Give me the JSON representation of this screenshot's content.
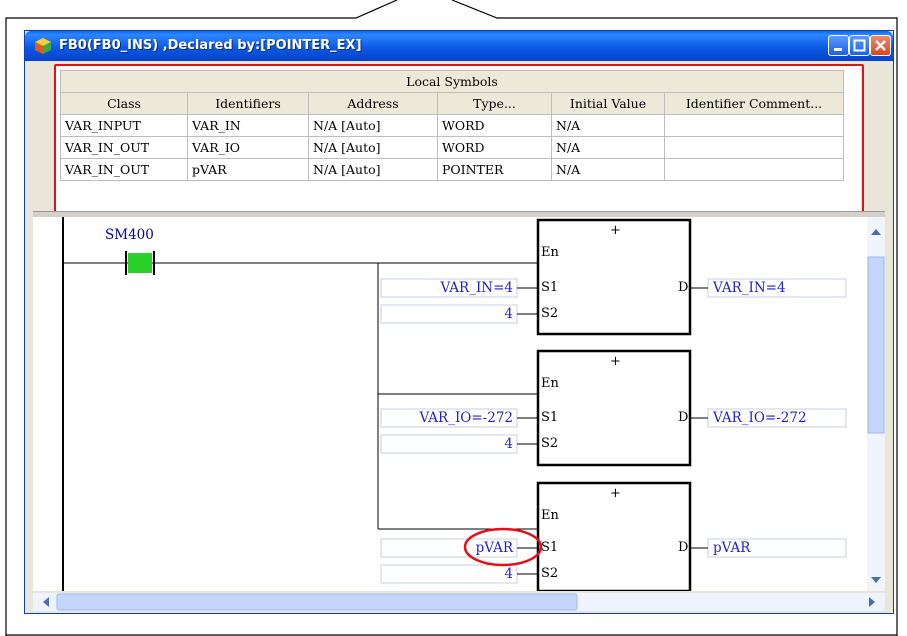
{
  "window": {
    "title": "FB0(FB0_INS) ,Declared by:[POINTER_EX]"
  },
  "symbols": {
    "caption": "Local Symbols",
    "columns": [
      "Class",
      "Identifiers",
      "Address",
      "Type...",
      "Initial Value",
      "Identifier Comment..."
    ],
    "rows": [
      [
        "VAR_INPUT",
        "VAR_IN",
        "N/A [Auto]",
        "WORD",
        "N/A",
        ""
      ],
      [
        "VAR_IN_OUT",
        "VAR_IO",
        "N/A [Auto]",
        "WORD",
        "N/A",
        ""
      ],
      [
        "VAR_IN_OUT",
        "pVAR",
        "N/A [Auto]",
        "POINTER",
        "N/A",
        ""
      ]
    ]
  },
  "ladder": {
    "contact": "SM400",
    "blocks": [
      {
        "op": "+",
        "en": "En",
        "s1": "S1",
        "s2": "S2",
        "d": "D",
        "s1_value": "VAR_IN=4",
        "s2_value": "4",
        "d_value": "VAR_IN=4"
      },
      {
        "op": "+",
        "en": "En",
        "s1": "S1",
        "s2": "S2",
        "d": "D",
        "s1_value": "VAR_IO=-272",
        "s2_value": "4",
        "d_value": "VAR_IO=-272"
      },
      {
        "op": "+",
        "en": "En",
        "s1": "S1",
        "s2": "S2",
        "d": "D",
        "s1_value": "pVAR",
        "s2_value": "4",
        "d_value": "pVAR"
      }
    ]
  },
  "colors": {
    "highlight": "#e3101a",
    "contact_on": "#2bd12b",
    "operand_text": "#1f1fd4",
    "titlebar": "#0b5ae6"
  }
}
